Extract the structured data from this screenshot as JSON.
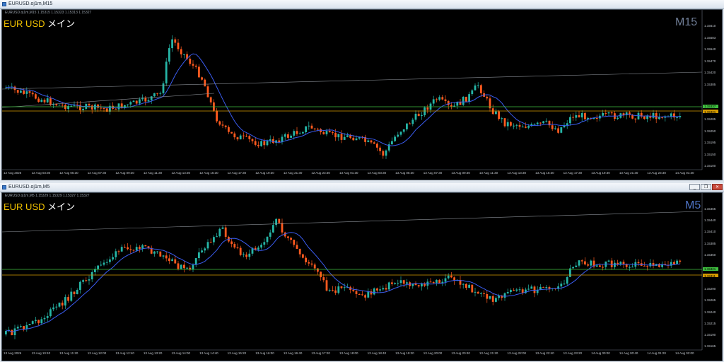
{
  "windows": [
    {
      "id": "m15",
      "window_title": "EURUSD.oj1m,M15",
      "info_line": "EURUSD.oj1m,M15  1.15315 1.15323 1.15313 1.15327",
      "symbol_label": "EUR USD",
      "symbol_jp": "メイン",
      "timeframe": "M15",
      "price_labels": [
        "1.15610",
        "1.15583",
        "1.15540",
        "1.15470",
        "1.15420",
        "1.15385",
        "1.15337",
        "1.15321",
        "1.15285",
        "1.15250",
        "1.15195",
        "1.15150",
        "1.15100"
      ],
      "time_labels": [
        "12 Aug 2026",
        "12 Aug 03:30",
        "12 Aug 05:30",
        "12 Aug 07:30",
        "12 Aug 09:30",
        "12 Aug 11:30",
        "12 Aug 13:30",
        "12 Aug 15:30",
        "12 Aug 17:30",
        "12 Aug 19:30",
        "12 Aug 21:30",
        "12 Aug 23:30",
        "13 Aug 01:30",
        "13 Aug 03:30",
        "13 Aug 05:30",
        "13 Aug 07:30",
        "13 Aug 09:30",
        "13 Aug 11:30",
        "13 Aug 13:30",
        "13 Aug 15:30",
        "13 Aug 17:30",
        "13 Aug 19:30",
        "13 Aug 21:30",
        "13 Aug 23:30",
        "14 Aug 01:30"
      ],
      "current_bid": "1.15337",
      "current_ask": "1.15321",
      "colors": {
        "bull": "#26b5a6",
        "bear": "#ff5a1f",
        "ma": "#3a5cf0",
        "bid_line": "#3fbf3f",
        "ask_line": "#d49a00"
      }
    },
    {
      "id": "m5",
      "window_title": "EURUSD.oj1m,M5",
      "info_line": "EURUSD.oj1m,M5  1.15329 1.15329 1.15327 1.15327",
      "symbol_label": "EUR USD",
      "symbol_jp": "メイン",
      "timeframe": "M5",
      "price_labels": [
        "1.15465",
        "1.15440",
        "1.15410",
        "1.15385",
        "1.15350",
        "1.15321",
        "1.15311",
        "1.15290",
        "1.15265",
        "1.15240",
        "1.15215",
        "1.15190",
        "1.15165"
      ],
      "time_labels": [
        "13 Aug 2026",
        "13 Aug 10:40",
        "13 Aug 11:20",
        "13 Aug 12:00",
        "13 Aug 12:40",
        "13 Aug 13:20",
        "13 Aug 14:00",
        "13 Aug 14:40",
        "13 Aug 15:20",
        "13 Aug 16:00",
        "13 Aug 16:40",
        "13 Aug 17:20",
        "13 Aug 18:00",
        "13 Aug 18:40",
        "13 Aug 19:20",
        "13 Aug 20:00",
        "13 Aug 20:40",
        "13 Aug 21:20",
        "13 Aug 22:00",
        "13 Aug 22:40",
        "13 Aug 23:20",
        "14 Aug 00:00",
        "14 Aug 00:40",
        "14 Aug 01:20",
        "14 Aug 02:00"
      ],
      "current_bid": "1.15321",
      "current_ask": "1.15311",
      "colors": {
        "bull": "#26b5a6",
        "bear": "#ff5a1f",
        "ma": "#3a5cf0",
        "bid_line": "#3fbf3f",
        "ask_line": "#d49a00"
      }
    }
  ],
  "window_buttons": {
    "minimize": "_",
    "restore": "❐",
    "close": "✕"
  }
}
